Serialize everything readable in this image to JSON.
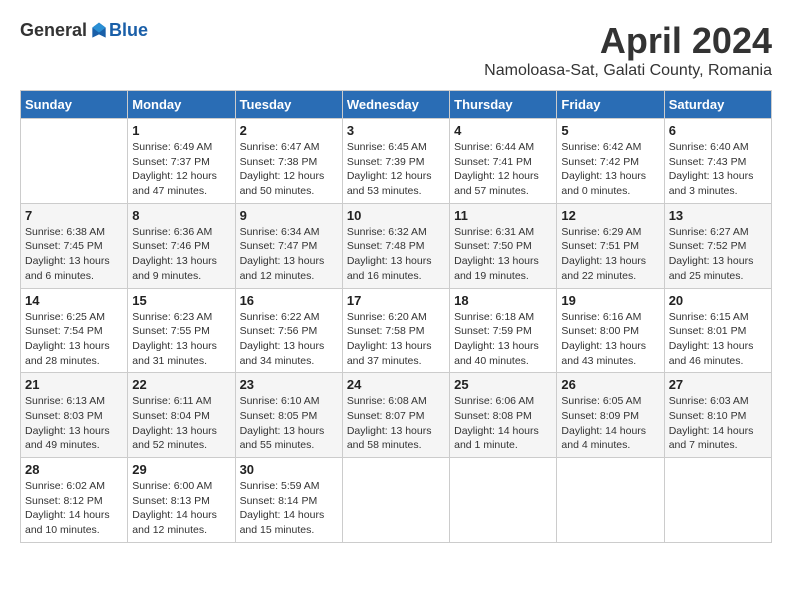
{
  "header": {
    "logo_general": "General",
    "logo_blue": "Blue",
    "title": "April 2024",
    "subtitle": "Namoloasa-Sat, Galati County, Romania"
  },
  "days_of_week": [
    "Sunday",
    "Monday",
    "Tuesday",
    "Wednesday",
    "Thursday",
    "Friday",
    "Saturday"
  ],
  "weeks": [
    [
      {
        "day": "",
        "info": ""
      },
      {
        "day": "1",
        "info": "Sunrise: 6:49 AM\nSunset: 7:37 PM\nDaylight: 12 hours\nand 47 minutes."
      },
      {
        "day": "2",
        "info": "Sunrise: 6:47 AM\nSunset: 7:38 PM\nDaylight: 12 hours\nand 50 minutes."
      },
      {
        "day": "3",
        "info": "Sunrise: 6:45 AM\nSunset: 7:39 PM\nDaylight: 12 hours\nand 53 minutes."
      },
      {
        "day": "4",
        "info": "Sunrise: 6:44 AM\nSunset: 7:41 PM\nDaylight: 12 hours\nand 57 minutes."
      },
      {
        "day": "5",
        "info": "Sunrise: 6:42 AM\nSunset: 7:42 PM\nDaylight: 13 hours\nand 0 minutes."
      },
      {
        "day": "6",
        "info": "Sunrise: 6:40 AM\nSunset: 7:43 PM\nDaylight: 13 hours\nand 3 minutes."
      }
    ],
    [
      {
        "day": "7",
        "info": "Sunrise: 6:38 AM\nSunset: 7:45 PM\nDaylight: 13 hours\nand 6 minutes."
      },
      {
        "day": "8",
        "info": "Sunrise: 6:36 AM\nSunset: 7:46 PM\nDaylight: 13 hours\nand 9 minutes."
      },
      {
        "day": "9",
        "info": "Sunrise: 6:34 AM\nSunset: 7:47 PM\nDaylight: 13 hours\nand 12 minutes."
      },
      {
        "day": "10",
        "info": "Sunrise: 6:32 AM\nSunset: 7:48 PM\nDaylight: 13 hours\nand 16 minutes."
      },
      {
        "day": "11",
        "info": "Sunrise: 6:31 AM\nSunset: 7:50 PM\nDaylight: 13 hours\nand 19 minutes."
      },
      {
        "day": "12",
        "info": "Sunrise: 6:29 AM\nSunset: 7:51 PM\nDaylight: 13 hours\nand 22 minutes."
      },
      {
        "day": "13",
        "info": "Sunrise: 6:27 AM\nSunset: 7:52 PM\nDaylight: 13 hours\nand 25 minutes."
      }
    ],
    [
      {
        "day": "14",
        "info": "Sunrise: 6:25 AM\nSunset: 7:54 PM\nDaylight: 13 hours\nand 28 minutes."
      },
      {
        "day": "15",
        "info": "Sunrise: 6:23 AM\nSunset: 7:55 PM\nDaylight: 13 hours\nand 31 minutes."
      },
      {
        "day": "16",
        "info": "Sunrise: 6:22 AM\nSunset: 7:56 PM\nDaylight: 13 hours\nand 34 minutes."
      },
      {
        "day": "17",
        "info": "Sunrise: 6:20 AM\nSunset: 7:58 PM\nDaylight: 13 hours\nand 37 minutes."
      },
      {
        "day": "18",
        "info": "Sunrise: 6:18 AM\nSunset: 7:59 PM\nDaylight: 13 hours\nand 40 minutes."
      },
      {
        "day": "19",
        "info": "Sunrise: 6:16 AM\nSunset: 8:00 PM\nDaylight: 13 hours\nand 43 minutes."
      },
      {
        "day": "20",
        "info": "Sunrise: 6:15 AM\nSunset: 8:01 PM\nDaylight: 13 hours\nand 46 minutes."
      }
    ],
    [
      {
        "day": "21",
        "info": "Sunrise: 6:13 AM\nSunset: 8:03 PM\nDaylight: 13 hours\nand 49 minutes."
      },
      {
        "day": "22",
        "info": "Sunrise: 6:11 AM\nSunset: 8:04 PM\nDaylight: 13 hours\nand 52 minutes."
      },
      {
        "day": "23",
        "info": "Sunrise: 6:10 AM\nSunset: 8:05 PM\nDaylight: 13 hours\nand 55 minutes."
      },
      {
        "day": "24",
        "info": "Sunrise: 6:08 AM\nSunset: 8:07 PM\nDaylight: 13 hours\nand 58 minutes."
      },
      {
        "day": "25",
        "info": "Sunrise: 6:06 AM\nSunset: 8:08 PM\nDaylight: 14 hours\nand 1 minute."
      },
      {
        "day": "26",
        "info": "Sunrise: 6:05 AM\nSunset: 8:09 PM\nDaylight: 14 hours\nand 4 minutes."
      },
      {
        "day": "27",
        "info": "Sunrise: 6:03 AM\nSunset: 8:10 PM\nDaylight: 14 hours\nand 7 minutes."
      }
    ],
    [
      {
        "day": "28",
        "info": "Sunrise: 6:02 AM\nSunset: 8:12 PM\nDaylight: 14 hours\nand 10 minutes."
      },
      {
        "day": "29",
        "info": "Sunrise: 6:00 AM\nSunset: 8:13 PM\nDaylight: 14 hours\nand 12 minutes."
      },
      {
        "day": "30",
        "info": "Sunrise: 5:59 AM\nSunset: 8:14 PM\nDaylight: 14 hours\nand 15 minutes."
      },
      {
        "day": "",
        "info": ""
      },
      {
        "day": "",
        "info": ""
      },
      {
        "day": "",
        "info": ""
      },
      {
        "day": "",
        "info": ""
      }
    ]
  ]
}
